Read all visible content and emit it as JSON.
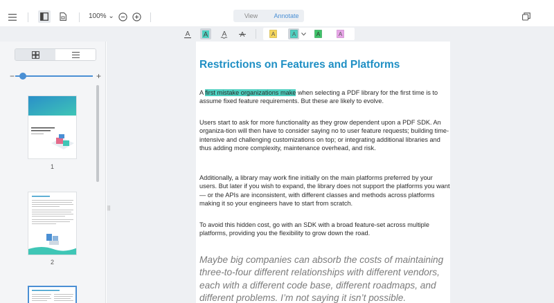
{
  "toolbar": {
    "zoom_label": "100%",
    "modes": [
      {
        "label": "View",
        "active": false
      },
      {
        "label": "Annotate",
        "active": true
      }
    ],
    "icons": [
      "menu-icon",
      "sidebar-toggle-icon",
      "document-icon",
      "zoom-dropdown-chevron-icon",
      "zoom-out-icon",
      "zoom-in-icon",
      "chat-icon"
    ]
  },
  "annotation_tools": [
    "underline-text-icon",
    "highlight-text-icon",
    "squiggly-text-icon",
    "strikeout-text-icon",
    "note-yellow-icon",
    "note-teal-icon",
    "note-green-icon",
    "note-pink-icon"
  ],
  "sidebar": {
    "tabs": [
      "thumbnails-icon",
      "outline-icon"
    ],
    "active_tab": "thumbnails",
    "zoom_slider_value": 0.1,
    "thumbnails": [
      {
        "page": "1",
        "cover_title": "3 Important Considerations Choosing a PDF Library"
      },
      {
        "page": "2",
        "cover_title": "Feature Scale Overview"
      },
      {
        "page": "",
        "cover_title": ""
      }
    ]
  },
  "document": {
    "title": "Restrictions on Features and Platforms",
    "p1_prefix": "A ",
    "p1_highlight": "first mistake organizations make",
    "p1_rest": " when selecting a PDF library for the first time is to assume fixed feature requirements. But these are likely to evolve.",
    "p2": "Users start to ask for more functionality as they grow dependent upon a PDF SDK. An organiza-tion will then have to consider saying no to user feature requests; building time-intensive and challenging customizations on top; or integrating additional libraries and thus adding more complexity, maintenance overhead, and risk.",
    "p3": "Additionally, a library may work fine initially on the main platforms preferred by your users. But later if you wish to expand, the library does not support the platforms you want — or the APIs are inconsistent, with different classes and methods across platforms making it so your engineers have to start from scratch.",
    "p4": "To avoid this hidden cost, go with an SDK with a broad feature-set across multiple platforms, providing you the flexibility to grow down the road.",
    "quote": "Maybe big companies can absorb the costs of maintaining three-to-four different relationships with different vendors, each with a different code base, different roadmaps, and different problems. I’m not saying it isn’t possible."
  },
  "colors": {
    "accent": "#4a8fd4",
    "title": "#1f8fc4",
    "highlight": "#4fd0c0"
  }
}
